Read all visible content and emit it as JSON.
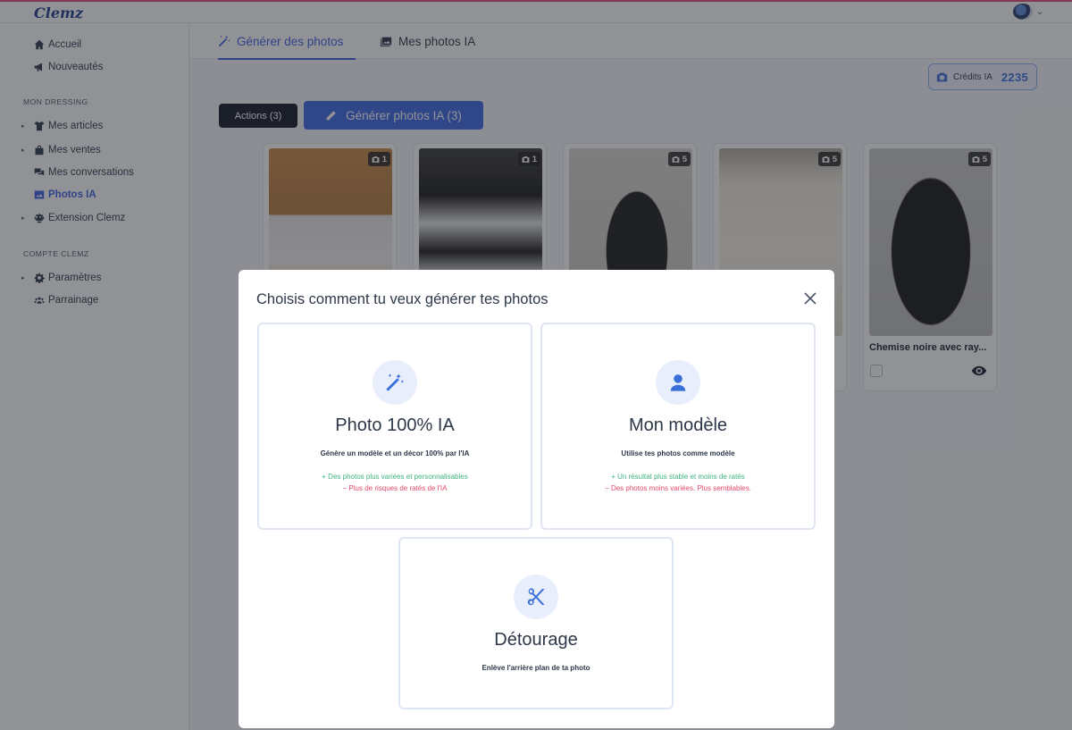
{
  "app": {
    "logo": "Clemz"
  },
  "sidebar": {
    "items_top": [
      {
        "label": "Accueil",
        "icon": "home-icon"
      },
      {
        "label": "Nouveautés",
        "icon": "megaphone-icon"
      }
    ],
    "section_dressing": "MON DRESSING",
    "items_dressing": [
      {
        "label": "Mes articles",
        "icon": "shirt-icon"
      },
      {
        "label": "Mes ventes",
        "icon": "bag-icon"
      },
      {
        "label": "Mes conversations",
        "icon": "chat-icon"
      },
      {
        "label": "Photos IA",
        "icon": "image-icon",
        "active": true
      },
      {
        "label": "Extension Clemz",
        "icon": "robot-icon"
      }
    ],
    "section_compte": "COMPTE CLEMZ",
    "items_compte": [
      {
        "label": "Paramètres",
        "icon": "gear-icon"
      },
      {
        "label": "Parrainage",
        "icon": "users-icon"
      }
    ]
  },
  "tabs": [
    {
      "label": "Générer des photos",
      "icon": "magic-wand-icon",
      "active": true
    },
    {
      "label": "Mes photos IA",
      "icon": "photos-icon"
    }
  ],
  "credits": {
    "label": "Crédits IA",
    "value": "2235"
  },
  "toolbar": {
    "actions_label": "Actions (3)",
    "generate_label": "Générer photos IA (3)"
  },
  "cards": [
    {
      "count": "1"
    },
    {
      "count": "1"
    },
    {
      "count": "5"
    },
    {
      "count": "5"
    },
    {
      "count": "5",
      "title": "Chemise noire avec ray..."
    }
  ],
  "modal": {
    "title": "Choisis comment tu veux générer tes photos",
    "options": [
      {
        "title": "Photo 100% IA",
        "icon": "magic-wand-icon",
        "description": "Génère un modèle et un décor 100% par l'IA",
        "pro": "+ Des photos plus variées et personnalisables",
        "con": "− Plus de risques de ratés de l'IA"
      },
      {
        "title": "Mon modèle",
        "icon": "user-icon",
        "description": "Utilise tes photos comme modèle",
        "pro": "+ Un résultat plus stable et moins de ratés",
        "con": "− Des photos moins variées. Plus semblables."
      },
      {
        "title": "Détourage",
        "icon": "scissors-icon",
        "description": "Enlève l'arrière plan de ta photo"
      }
    ]
  },
  "colors": {
    "accent": "#3b66e4",
    "pro": "#3fb27f",
    "con": "#e24a6a",
    "dark_button": "#121826"
  }
}
